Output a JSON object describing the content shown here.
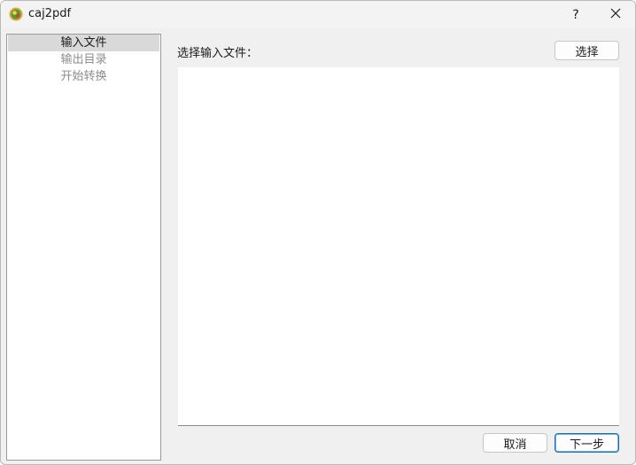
{
  "window": {
    "title": "caj2pdf",
    "help_label": "?"
  },
  "sidebar": {
    "items": [
      {
        "label": "输入文件",
        "active": true
      },
      {
        "label": "输出目录",
        "active": false
      },
      {
        "label": "开始转换",
        "active": false
      }
    ]
  },
  "main": {
    "select_label": "选择输入文件：",
    "choose_button": "选择",
    "file_list": []
  },
  "footer": {
    "cancel_button": "取消",
    "next_button": "下一步"
  },
  "colors": {
    "accent": "#0f6cbd",
    "active_item_bg": "#d9d9d9",
    "inactive_text": "#8c8c8c"
  }
}
